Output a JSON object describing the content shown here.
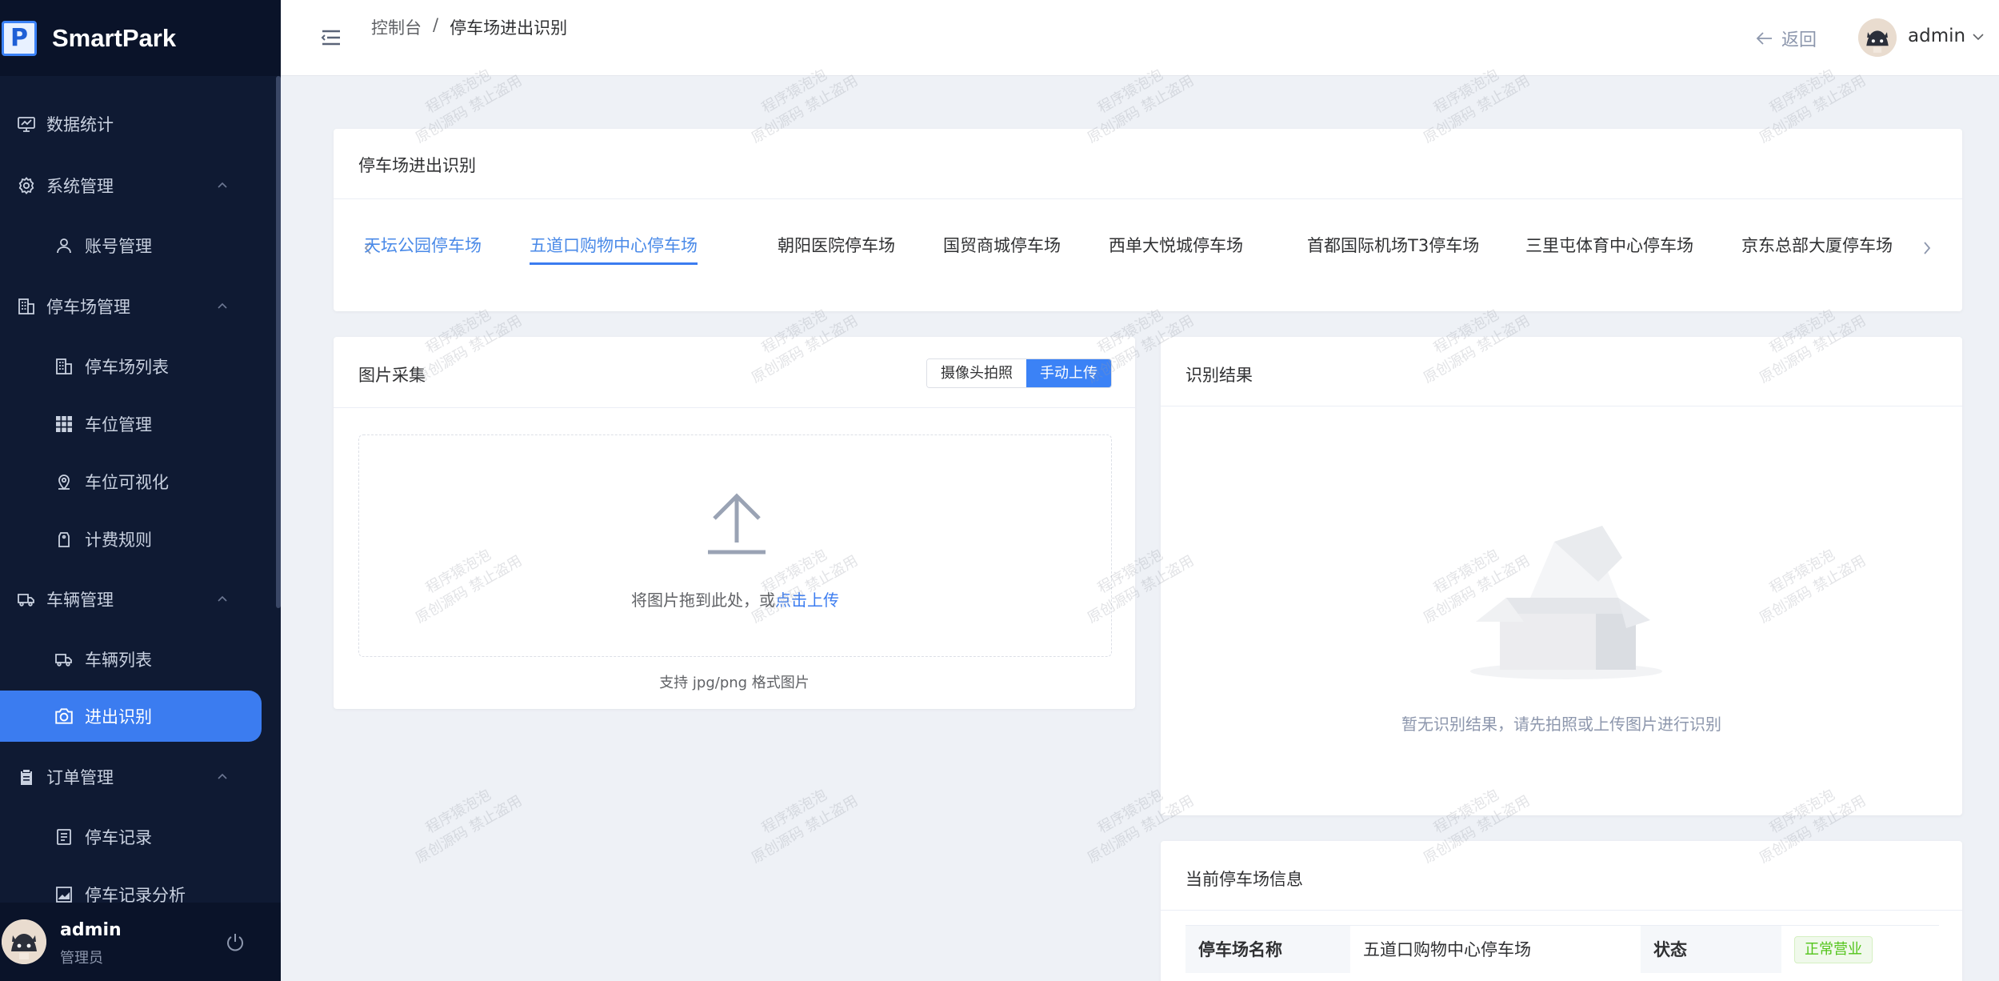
{
  "brand": {
    "logo_letter": "P",
    "name": "SmartPark"
  },
  "sidebar": {
    "items": [
      {
        "label": "数据统计",
        "icon": "monitor-chart-icon",
        "kind": "group"
      },
      {
        "label": "系统管理",
        "icon": "gear-icon",
        "kind": "group",
        "expanded": true
      },
      {
        "label": "账号管理",
        "icon": "user-icon",
        "kind": "sub"
      },
      {
        "label": "停车场管理",
        "icon": "building-icon",
        "kind": "group",
        "expanded": true
      },
      {
        "label": "停车场列表",
        "icon": "building-icon",
        "kind": "sub"
      },
      {
        "label": "车位管理",
        "icon": "grid-icon",
        "kind": "sub"
      },
      {
        "label": "车位可视化",
        "icon": "location-icon",
        "kind": "sub"
      },
      {
        "label": "计费规则",
        "icon": "price-tag-icon",
        "kind": "sub"
      },
      {
        "label": "车辆管理",
        "icon": "truck-icon",
        "kind": "group",
        "expanded": true
      },
      {
        "label": "车辆列表",
        "icon": "truck-icon",
        "kind": "sub"
      },
      {
        "label": "进出识别",
        "icon": "camera-icon",
        "kind": "sub",
        "active": true
      },
      {
        "label": "订单管理",
        "icon": "clipboard-icon",
        "kind": "group",
        "expanded": true
      },
      {
        "label": "停车记录",
        "icon": "document-icon",
        "kind": "sub"
      },
      {
        "label": "停车记录分析",
        "icon": "trend-chart-icon",
        "kind": "sub"
      }
    ],
    "footer": {
      "name": "admin",
      "role": "管理员"
    }
  },
  "header": {
    "breadcrumb": [
      "控制台",
      "/",
      "停车场进出识别"
    ],
    "back_label": "返回",
    "user": "admin"
  },
  "parking_card": {
    "title": "停车场进出识别",
    "tabs": [
      "天坛公园停车场",
      "五道口购物中心停车场",
      "朝阳医院停车场",
      "国贸商城停车场",
      "西单大悦城停车场",
      "首都国际机场T3停车场",
      "三里屯体育中心停车场",
      "京东总部大厦停车场"
    ],
    "active_tab_index": 1
  },
  "capture_card": {
    "title": "图片采集",
    "modes": [
      "摄像头拍照",
      "手动上传"
    ],
    "active_mode_index": 1,
    "upload_text": "将图片拖到此处，或",
    "upload_link": "点击上传",
    "upload_tip": "支持 jpg/png 格式图片"
  },
  "result_card": {
    "title": "识别结果",
    "empty_text": "暂无识别结果，请先拍照或上传图片进行识别"
  },
  "info_card": {
    "title": "当前停车场信息",
    "name_label": "停车场名称",
    "name_value": "五道口购物中心停车场",
    "status_label": "状态",
    "status_value": "正常营业"
  },
  "watermark": {
    "line1": "程序猿泡泡",
    "line2": "原创源码 禁止盗用"
  },
  "colors": {
    "sidebar_bg": "#0f1a33",
    "accent": "#3b7cf0",
    "status_ok": "#52c41a"
  }
}
